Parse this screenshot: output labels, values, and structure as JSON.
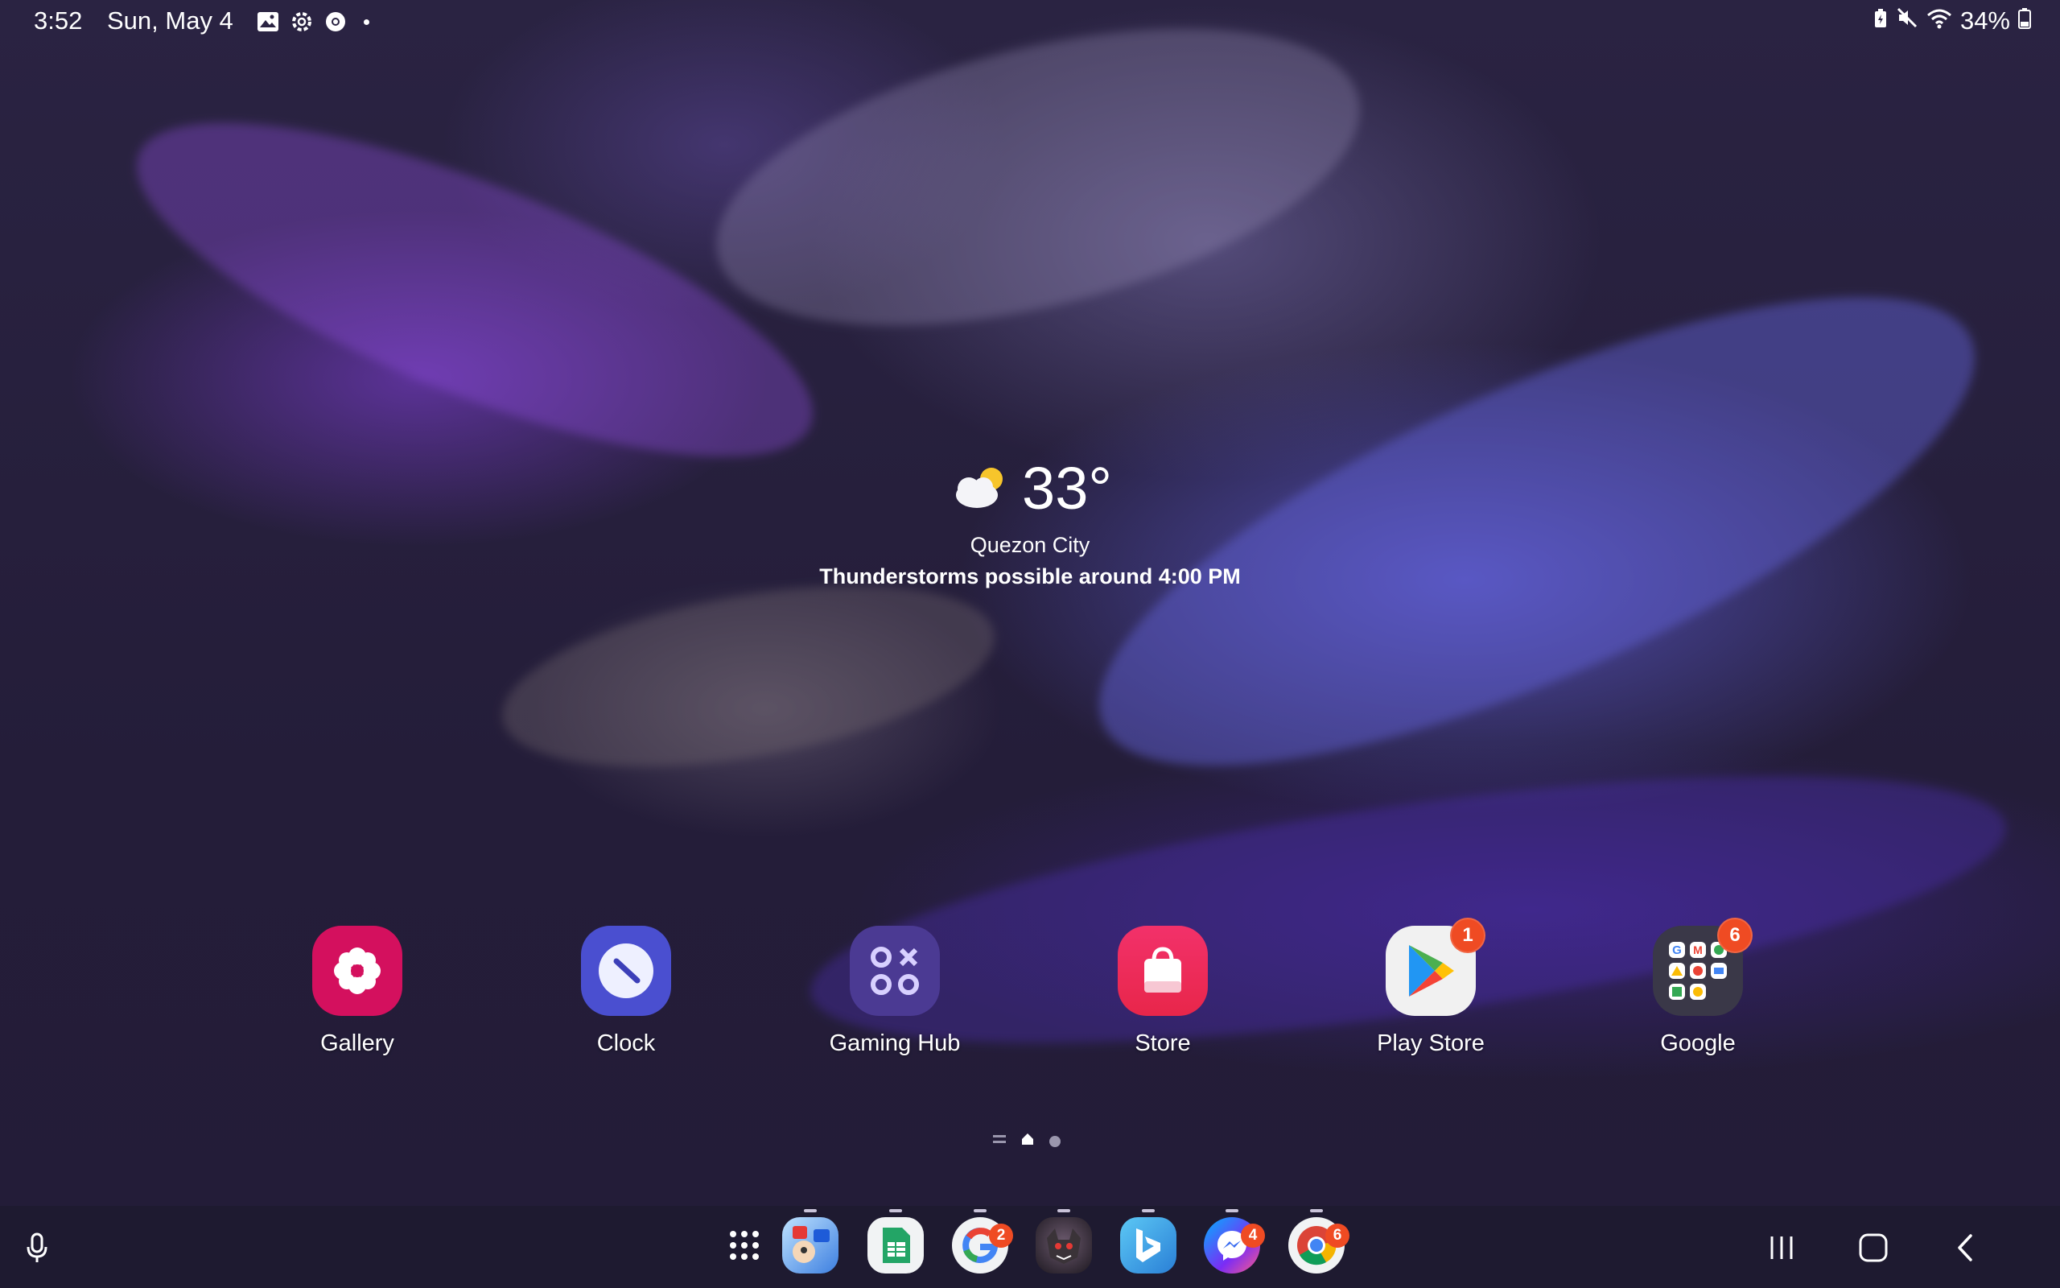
{
  "status_bar": {
    "time": "3:52",
    "date": "Sun, May 4",
    "left_icons": [
      "gallery-notification-icon",
      "settings-notification-icon",
      "chrome-notification-icon",
      "more-dot-icon"
    ],
    "right_icons": [
      "battery-saver-icon",
      "mute-icon",
      "wifi-icon"
    ],
    "battery": "34%"
  },
  "weather": {
    "temperature": "33°",
    "city": "Quezon City",
    "forecast": "Thunderstorms possible around 4:00 PM",
    "icon": "partly-cloudy-icon"
  },
  "home_apps": [
    {
      "label": "Gallery",
      "icon": "gallery-icon",
      "color": "#d4105e"
    },
    {
      "label": "Clock",
      "icon": "clock-icon",
      "color": "#4a4fd0"
    },
    {
      "label": "Gaming Hub",
      "icon": "gaming-hub-icon",
      "color": "#4b3a93"
    },
    {
      "label": "Store",
      "icon": "galaxy-store-icon",
      "color": "#e8264a"
    },
    {
      "label": "Play Store",
      "icon": "play-store-icon",
      "color": "#f1f1f1",
      "badge": "1"
    },
    {
      "label": "Google",
      "icon": "google-folder-icon",
      "color": "#3a3848",
      "badge": "6"
    }
  ],
  "page_indicator": {
    "pages": 3,
    "current": 2
  },
  "dock": {
    "apps": [
      {
        "icon": "apps-drawer-icon"
      },
      {
        "icon": "math-game-icon"
      },
      {
        "icon": "google-sheets-icon"
      },
      {
        "icon": "google-app-icon",
        "badge": "2"
      },
      {
        "icon": "game-monster-icon"
      },
      {
        "icon": "bing-icon"
      },
      {
        "icon": "messenger-icon",
        "badge": "4"
      },
      {
        "icon": "chrome-icon",
        "badge": "6"
      }
    ],
    "nav": [
      "recents-icon",
      "home-icon",
      "back-icon"
    ],
    "voice": "microphone-icon"
  }
}
